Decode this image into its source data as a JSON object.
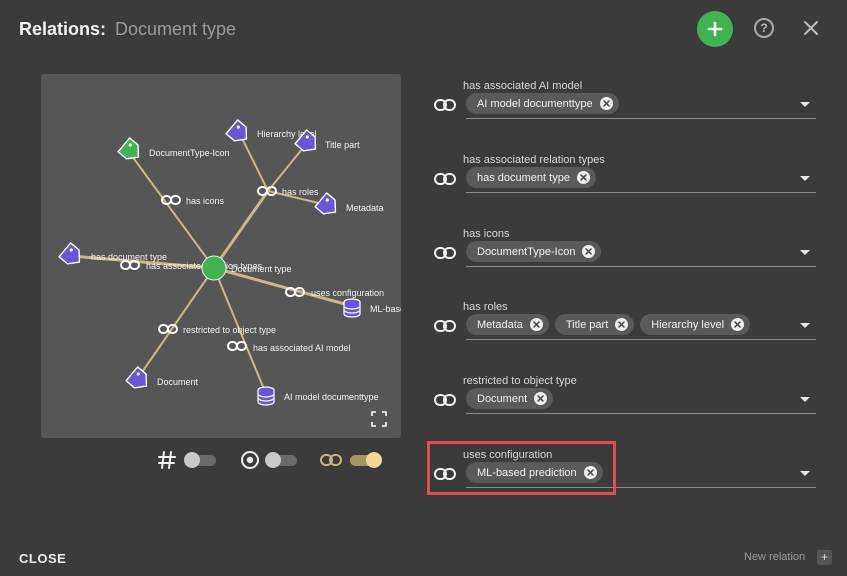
{
  "header": {
    "title": "Relations:",
    "subtitle": "Document type",
    "help_label": "?"
  },
  "colors": {
    "accent_green": "#3fb34f",
    "tag_purple": "#6a55d8",
    "edge": "#cdb784",
    "highlight": "#e34c50"
  },
  "graph": {
    "center_label": "Document type",
    "nodes": [
      {
        "label": "DocumentType-Icon",
        "icon": "tag-icon"
      },
      {
        "label": "Hierarchy level",
        "icon": "tag-icon"
      },
      {
        "label": "Title part",
        "icon": "tag-icon"
      },
      {
        "label": "Metadata",
        "icon": "tag-icon"
      },
      {
        "label": "has document type",
        "icon": "tag-icon"
      },
      {
        "label": "ML-based",
        "icon": "database-icon"
      },
      {
        "label": "Document",
        "icon": "tag-icon"
      },
      {
        "label": "AI model documenttype",
        "icon": "database-icon"
      }
    ],
    "edges": [
      {
        "label": "has icons"
      },
      {
        "label": "has roles"
      },
      {
        "label": "has associated relation types"
      },
      {
        "label": "uses configuration"
      },
      {
        "label": "restricted to object type"
      },
      {
        "label": "has associated AI model"
      }
    ]
  },
  "toggles": [
    {
      "icon": "hash-icon",
      "on": false
    },
    {
      "icon": "target-icon",
      "on": false
    },
    {
      "icon": "link-icon",
      "on": true
    }
  ],
  "relations": [
    {
      "label": "has associated AI model",
      "values": [
        "AI model documenttype"
      ]
    },
    {
      "label": "has associated relation types",
      "values": [
        "has document type"
      ]
    },
    {
      "label": "has icons",
      "values": [
        "DocumentType-Icon"
      ]
    },
    {
      "label": "has roles",
      "values": [
        "Metadata",
        "Title part",
        "Hierarchy level"
      ]
    },
    {
      "label": "restricted to object type",
      "values": [
        "Document"
      ]
    },
    {
      "label": "uses configuration",
      "values": [
        "ML-based prediction"
      ]
    }
  ],
  "footer": {
    "close_label": "CLOSE",
    "new_relation_label": "New relation",
    "plus_label": "+"
  }
}
